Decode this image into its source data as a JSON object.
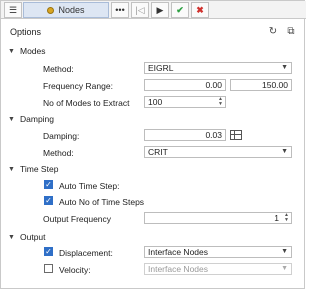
{
  "toolbar": {
    "menu_icon": "hamburger-icon",
    "title": "Nodes",
    "more_label": "•••",
    "first_label": "|◁",
    "play_label": "▶",
    "ok_label": "✔",
    "cancel_label": "✖"
  },
  "panel": {
    "heading": "Options"
  },
  "modes": {
    "label": "Modes",
    "method_label": "Method:",
    "method_value": "EIGRL",
    "frequency_label": "Frequency Range:",
    "freq_min": "0.00",
    "freq_max": "150.00",
    "nmodes_label": "No of Modes to Extract",
    "nmodes_value": "100"
  },
  "damping": {
    "label": "Damping",
    "damping_label": "Damping:",
    "damping_value": "0.03",
    "method_label": "Method:",
    "method_value": "CRIT"
  },
  "timestep": {
    "label": "Time Step",
    "auto_time_step_label": "Auto Time Step:",
    "auto_time_step_checked": true,
    "auto_no_label": "Auto No of Time Steps",
    "auto_no_checked": true,
    "output_freq_label": "Output Frequency",
    "output_freq_value": "1"
  },
  "output": {
    "label": "Output",
    "displacement_label": "Displacement:",
    "displacement_checked": true,
    "displacement_value": "Interface Nodes",
    "velocity_label": "Velocity:",
    "velocity_checked": false,
    "velocity_value": "Interface Nodes"
  }
}
